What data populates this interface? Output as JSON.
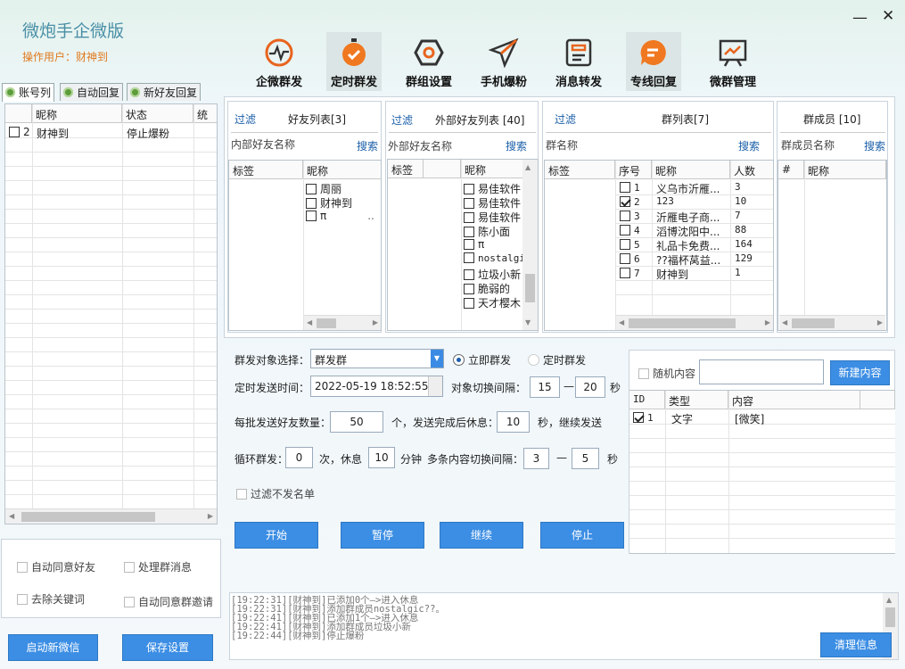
{
  "app": {
    "title": "微炮手企微版",
    "user_line": "操作用户：财神到"
  },
  "toolbar": [
    {
      "label": "企微群发",
      "icon": "pulse-icon"
    },
    {
      "label": "定时群发",
      "icon": "clock-check-icon"
    },
    {
      "label": "群组设置",
      "icon": "hexagon-icon"
    },
    {
      "label": "手机爆粉",
      "icon": "paper-plane-icon"
    },
    {
      "label": "消息转发",
      "icon": "message-doc-icon"
    },
    {
      "label": "专线回复",
      "icon": "chat-bubble-icon"
    },
    {
      "label": "微群管理",
      "icon": "chart-board-icon"
    }
  ],
  "left_tabs": [
    "账号列",
    "自动回复",
    "新好友回复"
  ],
  "account_table": {
    "headers": [
      "昵称",
      "状态",
      "统"
    ],
    "rows": [
      {
        "index": "2",
        "name": "财神到",
        "status": "停止爆粉"
      }
    ]
  },
  "left_options": {
    "auto_accept_friend": "自动同意好友",
    "handle_group_msg": "处理群消息",
    "remove_keywords": "去除关键词",
    "auto_accept_group_invite": "自动同意群邀请"
  },
  "left_buttons": {
    "launch": "启动新微信",
    "save": "保存设置"
  },
  "friends": {
    "filter": "过滤",
    "title": "好友列表[3]",
    "search_label": "内部好友名称",
    "search": "搜索",
    "col_tag": "标签",
    "col_name": "昵称",
    "names": [
      "周丽",
      "财神到",
      "π"
    ]
  },
  "external": {
    "filter": "过滤",
    "title": "外部好友列表 [40]",
    "search_label": "外部好友名称",
    "search": "搜索",
    "col_tag": "标签",
    "col_name": "昵称",
    "names": [
      "易佳软件",
      "易佳软件",
      "易佳软件",
      "陈小面",
      "π",
      "nostalgi",
      "垃圾小新",
      "脆弱的",
      "天才樱木"
    ]
  },
  "groups": {
    "filter": "过滤",
    "title": "群列表[7]",
    "search_label": "群名称",
    "search": "搜索",
    "col_tag": "标签",
    "col_no": "序号",
    "col_name": "昵称",
    "col_count": "人数",
    "rows": [
      {
        "no": "1",
        "name": "义乌市沂雁...",
        "count": "3",
        "checked": false
      },
      {
        "no": "2",
        "name": "123",
        "count": "10",
        "checked": true
      },
      {
        "no": "3",
        "name": "沂雁电子商...",
        "count": "7",
        "checked": false
      },
      {
        "no": "4",
        "name": "滔博沈阳中...",
        "count": "88",
        "checked": false
      },
      {
        "no": "5",
        "name": "礼品卡免费...",
        "count": "164",
        "checked": false
      },
      {
        "no": "6",
        "name": "??福杯莴益...",
        "count": "129",
        "checked": false
      },
      {
        "no": "7",
        "name": "财神到",
        "count": "1",
        "checked": false
      }
    ]
  },
  "members": {
    "title": "群成员 [10]",
    "search_label": "群成员名称",
    "search": "搜索",
    "col_hash": "#",
    "col_name": "昵称"
  },
  "settings": {
    "target_label": "群发对象选择：",
    "target_value": "群发群",
    "now_label": "立即群发",
    "timed_label": "定时群发",
    "time_label": "定时发送时间：",
    "time_value": "2022-05-19 18:52:55",
    "switch_label": "对象切换间隔：",
    "switch_min": "15",
    "dash": "—",
    "switch_max": "20",
    "sec": "秒",
    "batch_label": "每批发送好友数量：",
    "batch_value": "50",
    "batch_mid": "个，发送完成后休息：",
    "rest_value": "10",
    "batch_tail": "秒，继续发送",
    "loop_label": "循环群发：",
    "loop_value": "0",
    "loop_mid": "次，休息",
    "loop_rest": "10",
    "minute": "分钟",
    "multi_label": "多条内容切换间隔：",
    "multi_min": "3",
    "multi_max": "5",
    "filter_label": "过滤不发名单"
  },
  "action_buttons": [
    "开始",
    "暂停",
    "继续",
    "停止"
  ],
  "content": {
    "random_label": "随机内容",
    "new_button": "新建内容",
    "col_id": "ID",
    "col_type": "类型",
    "col_content": "内容",
    "rows": [
      {
        "id": "1",
        "type": "文字",
        "content": "[微笑]",
        "checked": true
      }
    ]
  },
  "log": {
    "lines": [
      "[19:22:31][财神到]已添加0个—>进入休息",
      "[19:22:31][财神到]添加群成员nostalgic??。",
      "[19:22:41][财神到]已添加1个—>进入休息",
      "[19:22:41][财神到]添加群成员垃圾小新",
      "[19:22:44][财神到]停止爆粉"
    ],
    "clear_button": "清理信息"
  },
  "window": {
    "minimize": "—",
    "close": "✕"
  }
}
